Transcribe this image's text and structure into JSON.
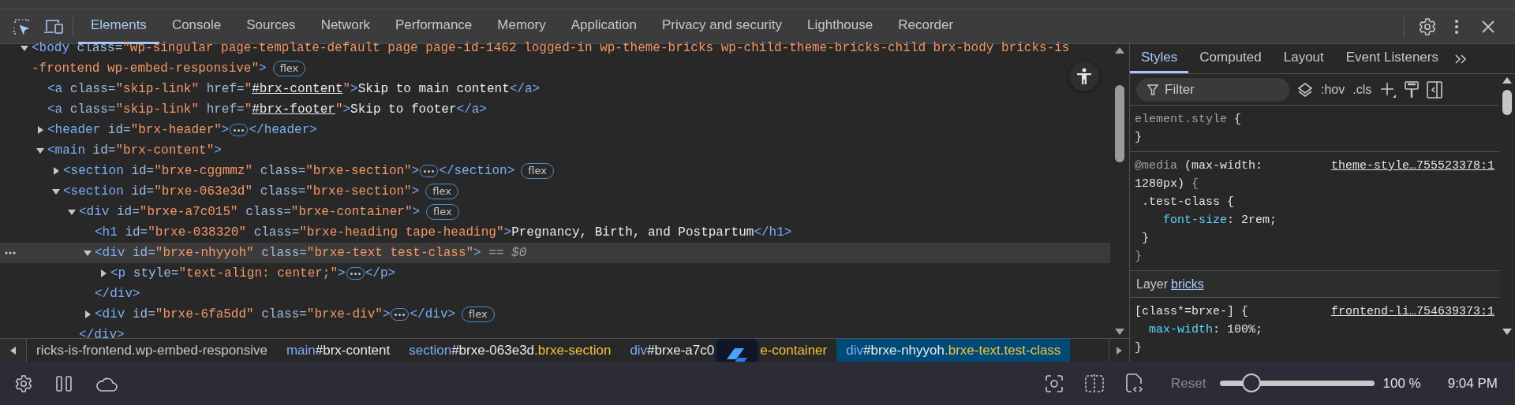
{
  "toolbar": {
    "tabs": [
      {
        "label": "Elements",
        "selected": true
      },
      {
        "label": "Console",
        "selected": false
      },
      {
        "label": "Sources",
        "selected": false
      },
      {
        "label": "Network",
        "selected": false
      },
      {
        "label": "Performance",
        "selected": false
      },
      {
        "label": "Memory",
        "selected": false
      },
      {
        "label": "Application",
        "selected": false
      },
      {
        "label": "Privacy and security",
        "selected": false
      },
      {
        "label": "Lighthouse",
        "selected": false
      },
      {
        "label": "Recorder",
        "selected": false
      }
    ]
  },
  "dom_tree": [
    {
      "kind": "parent",
      "expanded": true,
      "selected": false,
      "open": [
        {
          "kind": "tag",
          "text": "<body"
        },
        {
          "kind": "attr",
          "text": " class="
        },
        {
          "kind": "value_line_end",
          "text": "\"wp-singular page-template-default page page-id-1462 logged-in wp-theme-bricks wp-child-theme-bricks-child brx-body bricks-is"
        },
        {
          "kind": "value",
          "text": "-frontend wp-embed-responsive\""
        },
        {
          "kind": "tag",
          "text": ">"
        }
      ],
      "badge": "flex",
      "children": [
        {
          "kind": "leaf",
          "selected": false,
          "open": [
            {
              "kind": "tag",
              "text": "<a"
            },
            {
              "kind": "attr",
              "text": " class="
            },
            {
              "kind": "value",
              "text": "\"skip-link\""
            },
            {
              "kind": "attr",
              "text": " href="
            },
            {
              "kind": "value",
              "text": "\""
            },
            {
              "kind": "link",
              "text": "#brx-content"
            },
            {
              "kind": "value",
              "text": "\""
            },
            {
              "kind": "tag",
              "text": ">"
            },
            {
              "kind": "text",
              "text": "Skip to main content"
            },
            {
              "kind": "tag",
              "text": "</a>"
            }
          ]
        },
        {
          "kind": "leaf",
          "selected": false,
          "open": [
            {
              "kind": "tag",
              "text": "<a"
            },
            {
              "kind": "attr",
              "text": " class="
            },
            {
              "kind": "value",
              "text": "\"skip-link\""
            },
            {
              "kind": "attr",
              "text": " href="
            },
            {
              "kind": "value",
              "text": "\""
            },
            {
              "kind": "link",
              "text": "#brx-footer"
            },
            {
              "kind": "value",
              "text": "\""
            },
            {
              "kind": "tag",
              "text": ">"
            },
            {
              "kind": "text",
              "text": "Skip to footer"
            },
            {
              "kind": "tag",
              "text": "</a>"
            }
          ]
        },
        {
          "kind": "parent",
          "expanded": false,
          "selected": false,
          "open": [
            {
              "kind": "tag",
              "text": "<header"
            },
            {
              "kind": "attr",
              "text": " id="
            },
            {
              "kind": "value",
              "text": "\"brx-header\""
            },
            {
              "kind": "tag",
              "text": ">"
            }
          ],
          "close": [
            {
              "kind": "tag",
              "text": "</header>"
            }
          ]
        },
        {
          "kind": "parent",
          "expanded": true,
          "selected": false,
          "open": [
            {
              "kind": "tag",
              "text": "<main"
            },
            {
              "kind": "attr",
              "text": " id="
            },
            {
              "kind": "value",
              "text": "\"brx-content\""
            },
            {
              "kind": "tag",
              "text": ">"
            }
          ],
          "children": [
            {
              "kind": "parent",
              "expanded": false,
              "selected": false,
              "open": [
                {
                  "kind": "tag",
                  "text": "<section"
                },
                {
                  "kind": "attr",
                  "text": " id="
                },
                {
                  "kind": "value",
                  "text": "\"brxe-cggmmz\""
                },
                {
                  "kind": "attr",
                  "text": " class="
                },
                {
                  "kind": "value",
                  "text": "\"brxe-section\""
                },
                {
                  "kind": "tag",
                  "text": ">"
                }
              ],
              "close": [
                {
                  "kind": "tag",
                  "text": "</section>"
                }
              ],
              "badge": "flex"
            },
            {
              "kind": "parent",
              "expanded": true,
              "selected": false,
              "open": [
                {
                  "kind": "tag",
                  "text": "<section"
                },
                {
                  "kind": "attr",
                  "text": " id="
                },
                {
                  "kind": "value",
                  "text": "\"brxe-063e3d\""
                },
                {
                  "kind": "attr",
                  "text": " class="
                },
                {
                  "kind": "value",
                  "text": "\"brxe-section\""
                },
                {
                  "kind": "tag",
                  "text": ">"
                }
              ],
              "badge": "flex",
              "children": [
                {
                  "kind": "parent",
                  "expanded": true,
                  "selected": false,
                  "open": [
                    {
                      "kind": "tag",
                      "text": "<div"
                    },
                    {
                      "kind": "attr",
                      "text": " id="
                    },
                    {
                      "kind": "value",
                      "text": "\"brxe-a7c015\""
                    },
                    {
                      "kind": "attr",
                      "text": " class="
                    },
                    {
                      "kind": "value",
                      "text": "\"brxe-container\""
                    },
                    {
                      "kind": "tag",
                      "text": ">"
                    }
                  ],
                  "badge": "flex",
                  "close": [
                    {
                      "kind": "tag",
                      "text": "</div>"
                    }
                  ],
                  "children": [
                    {
                      "kind": "leaf",
                      "selected": false,
                      "open": [
                        {
                          "kind": "tag",
                          "text": "<h1"
                        },
                        {
                          "kind": "attr",
                          "text": " id="
                        },
                        {
                          "kind": "value",
                          "text": "\"brxe-038320\""
                        },
                        {
                          "kind": "attr",
                          "text": " class="
                        },
                        {
                          "kind": "value",
                          "text": "\"brxe-heading tape-heading\""
                        },
                        {
                          "kind": "tag",
                          "text": ">"
                        },
                        {
                          "kind": "text",
                          "text": "Pregnancy, Birth, and Postpartum"
                        },
                        {
                          "kind": "tag",
                          "text": "</h1>"
                        }
                      ]
                    },
                    {
                      "kind": "parent",
                      "expanded": true,
                      "selected": true,
                      "open": [
                        {
                          "kind": "tag",
                          "text": "<div"
                        },
                        {
                          "kind": "attr",
                          "text": " id="
                        },
                        {
                          "kind": "value",
                          "text": "\"brxe-nhyyoh\""
                        },
                        {
                          "kind": "attr",
                          "text": " class="
                        },
                        {
                          "kind": "value",
                          "text": "\"brxe-text test-class\""
                        },
                        {
                          "kind": "tag",
                          "text": ">"
                        },
                        {
                          "kind": "ref",
                          "text": " == $0"
                        }
                      ],
                      "close": [
                        {
                          "kind": "tag",
                          "text": "</div>"
                        }
                      ],
                      "children": [
                        {
                          "kind": "parent",
                          "expanded": false,
                          "selected": false,
                          "open": [
                            {
                              "kind": "tag",
                              "text": "<p"
                            },
                            {
                              "kind": "attr",
                              "text": " style="
                            },
                            {
                              "kind": "value",
                              "text": "\"text-align: center;\""
                            },
                            {
                              "kind": "tag",
                              "text": ">"
                            }
                          ],
                          "close": [
                            {
                              "kind": "tag",
                              "text": "</p>"
                            }
                          ]
                        }
                      ]
                    },
                    {
                      "kind": "parent",
                      "expanded": false,
                      "selected": false,
                      "open": [
                        {
                          "kind": "tag",
                          "text": "<div"
                        },
                        {
                          "kind": "attr",
                          "text": " id="
                        },
                        {
                          "kind": "value",
                          "text": "\"brxe-6fa5dd\""
                        },
                        {
                          "kind": "attr",
                          "text": " class="
                        },
                        {
                          "kind": "value",
                          "text": "\"brxe-div\""
                        },
                        {
                          "kind": "tag",
                          "text": ">"
                        }
                      ],
                      "close": [
                        {
                          "kind": "tag",
                          "text": "</div>"
                        }
                      ],
                      "badge": "flex"
                    }
                  ]
                }
              ]
            }
          ]
        }
      ]
    }
  ],
  "breadcrumbs": [
    {
      "kind": "plain",
      "selected": false,
      "parts": [
        {
          "kind": "plain",
          "text": "ricks-is-frontend.wp-embed-responsive"
        }
      ]
    },
    {
      "kind": "plain",
      "selected": false,
      "parts": [
        {
          "kind": "tag",
          "text": "main"
        },
        {
          "kind": "id",
          "text": "#brx-content"
        }
      ]
    },
    {
      "kind": "plain",
      "selected": false,
      "parts": [
        {
          "kind": "tag",
          "text": "section"
        },
        {
          "kind": "id",
          "text": "#brxe-063e3d"
        },
        {
          "kind": "class",
          "text": ".brxe-section"
        }
      ]
    },
    {
      "kind": "covered",
      "selected": false,
      "parts": [
        {
          "kind": "tag",
          "text": "div"
        },
        {
          "kind": "id",
          "text": "#brxe-a7c0"
        },
        {
          "kind": "class",
          "text": "e-container"
        }
      ]
    },
    {
      "kind": "plain",
      "selected": true,
      "parts": [
        {
          "kind": "tag",
          "text": "div"
        },
        {
          "kind": "id",
          "text": "#brxe-nhyyoh"
        },
        {
          "kind": "class",
          "text": ".brxe-text.test-class"
        }
      ]
    }
  ],
  "styles_pane": {
    "tabs": [
      {
        "label": "Styles",
        "selected": true
      },
      {
        "label": "Computed",
        "selected": false
      },
      {
        "label": "Layout",
        "selected": false
      },
      {
        "label": "Event Listeners",
        "selected": false
      }
    ],
    "filter": {
      "placeholder": "Filter"
    },
    "toggles": [
      ":hov",
      ".cls"
    ],
    "rules": [
      {
        "kind": "rule",
        "lines": [
          [
            {
              "kind": "dim",
              "text": "element.style"
            },
            {
              "kind": "plain",
              "text": " {"
            }
          ],
          [
            {
              "kind": "plain",
              "text": "}"
            }
          ]
        ]
      },
      {
        "kind": "rule",
        "source": "theme-style…755523378:1",
        "lines": [
          [
            {
              "kind": "dim",
              "text": "@media"
            },
            {
              "kind": "plain",
              "text": " (max-width:"
            }
          ],
          [
            {
              "kind": "plain",
              "text": "1280px)"
            },
            {
              "kind": "dim",
              "text": " {"
            }
          ],
          [
            {
              "kind": "plain",
              "text": " .test-class {"
            }
          ],
          [
            {
              "kind": "prop",
              "text": "    font-size"
            },
            {
              "kind": "plain",
              "text": ": 2rem;"
            }
          ],
          [
            {
              "kind": "plain",
              "text": " }"
            }
          ],
          [
            {
              "kind": "dim",
              "text": "}"
            }
          ]
        ]
      },
      {
        "kind": "layer",
        "label": "Layer",
        "link": "bricks"
      },
      {
        "kind": "rule",
        "source": "frontend-li…754639373:1",
        "lines": [
          [
            {
              "kind": "plain",
              "text": "[class*=brxe-] {"
            }
          ],
          [
            {
              "kind": "prop",
              "text": "  max-width"
            },
            {
              "kind": "plain",
              "text": ": 100%;"
            }
          ],
          [
            {
              "kind": "plain",
              "text": "}"
            }
          ]
        ]
      }
    ]
  },
  "status_bar": {
    "reset": "Reset",
    "zoom": {
      "level": 0.2
    },
    "zoom_reading": "100 %",
    "time": "9:04 PM"
  }
}
